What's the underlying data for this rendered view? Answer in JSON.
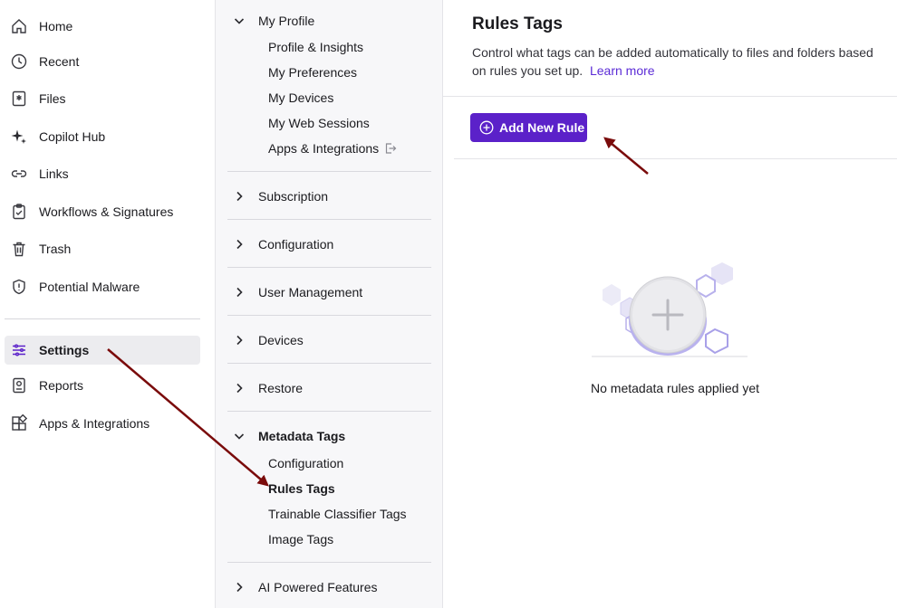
{
  "nav": {
    "items": [
      {
        "label": "Home",
        "icon": "home-icon"
      },
      {
        "label": "Recent",
        "icon": "clock-icon"
      },
      {
        "label": "Files",
        "icon": "files-icon"
      },
      {
        "label": "Copilot Hub",
        "icon": "sparkle-icon"
      },
      {
        "label": "Links",
        "icon": "link-icon"
      },
      {
        "label": "Workflows & Signatures",
        "icon": "clipboard-check-icon"
      },
      {
        "label": "Trash",
        "icon": "trash-icon"
      },
      {
        "label": "Potential Malware",
        "icon": "shield-alert-icon"
      },
      {
        "label": "Settings",
        "icon": "sliders-icon",
        "active": true
      },
      {
        "label": "Reports",
        "icon": "report-icon"
      },
      {
        "label": "Apps & Integrations",
        "icon": "apps-icon"
      }
    ]
  },
  "settings": {
    "my_profile": {
      "label": "My Profile",
      "links": [
        "Profile & Insights",
        "My Preferences",
        "My Devices",
        "My Web Sessions",
        "Apps & Integrations"
      ]
    },
    "subscription": "Subscription",
    "configuration": "Configuration",
    "user_management": "User Management",
    "devices": "Devices",
    "restore": "Restore",
    "metadata_tags": {
      "label": "Metadata Tags",
      "links": [
        "Configuration",
        "Rules Tags",
        "Trainable Classifier Tags",
        "Image Tags"
      ],
      "active_link": "Rules Tags"
    },
    "ai_powered": "AI Powered Features"
  },
  "main": {
    "title": "Rules Tags",
    "description": "Control what tags can be added automatically to files and folders based on rules you set up.",
    "learn_more": "Learn more",
    "add_button": "Add New Rule",
    "empty_text": "No metadata rules applied yet"
  },
  "colors": {
    "accent": "#5b21c9",
    "link": "#5b2bd6",
    "annotation_arrow": "#7a0b0b"
  }
}
